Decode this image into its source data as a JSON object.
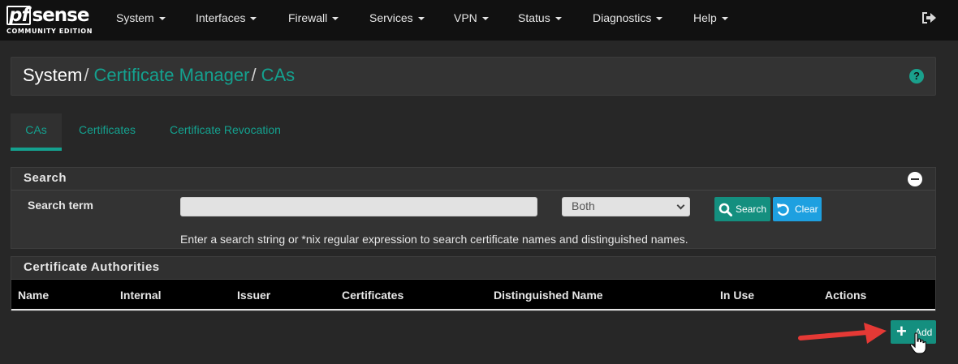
{
  "navbar": {
    "logo_pf": "pf",
    "logo_sense": "sense",
    "logo_edition": "COMMUNITY EDITION",
    "menus": [
      "System",
      "Interfaces",
      "Firewall",
      "Services",
      "VPN",
      "Status",
      "Diagnostics",
      "Help"
    ]
  },
  "breadcrumb": {
    "root": "System",
    "sep": "/",
    "level1": "Certificate Manager",
    "level2": "CAs"
  },
  "tabs": [
    "CAs",
    "Certificates",
    "Certificate Revocation"
  ],
  "search_panel": {
    "title": "Search",
    "term_label": "Search term",
    "input_value": "",
    "select_value": "Both",
    "search_button": "Search",
    "clear_button": "Clear",
    "help_text": "Enter a search string or *nix regular expression to search certificate names and distinguished names."
  },
  "ca_panel": {
    "title": "Certificate Authorities",
    "columns": [
      "Name",
      "Internal",
      "Issuer",
      "Certificates",
      "Distinguished Name",
      "In Use",
      "Actions"
    ]
  },
  "add_button": {
    "label": "Add"
  },
  "colors": {
    "accent": "#14a18f",
    "button_green": "#148f7f",
    "button_blue": "#1ea0e0",
    "annotation_arrow": "#e53935"
  }
}
